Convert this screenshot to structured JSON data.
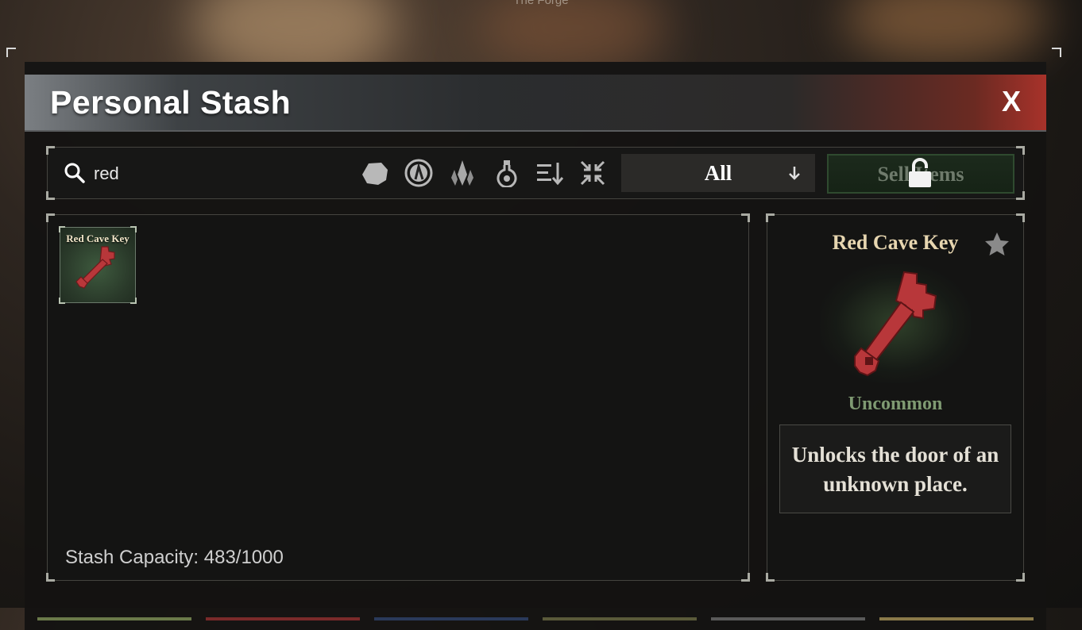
{
  "top_caption": "The Forge",
  "window": {
    "title": "Personal Stash",
    "close_label": "X"
  },
  "toolbar": {
    "search_value": "red",
    "filter_icons": [
      "stone-filter-icon",
      "coin-filter-icon",
      "crystal-filter-icon",
      "potion-filter-icon",
      "sort-icon",
      "collapse-icon"
    ],
    "dropdown_selected": "All",
    "sell_label": "Sell Items"
  },
  "grid": {
    "items": [
      {
        "label": "Red Cave Key"
      }
    ],
    "capacity_text": "Stash Capacity: 483/1000"
  },
  "detail": {
    "name": "Red Cave Key",
    "rarity": "Uncommon",
    "description": "Unlocks the door of an unknown place."
  },
  "colors": {
    "key_red": "#b8373a",
    "rarity_uncommon": "#7f9a72",
    "item_name": "#e7d6b0",
    "sell_green": "#2f4a2f"
  }
}
